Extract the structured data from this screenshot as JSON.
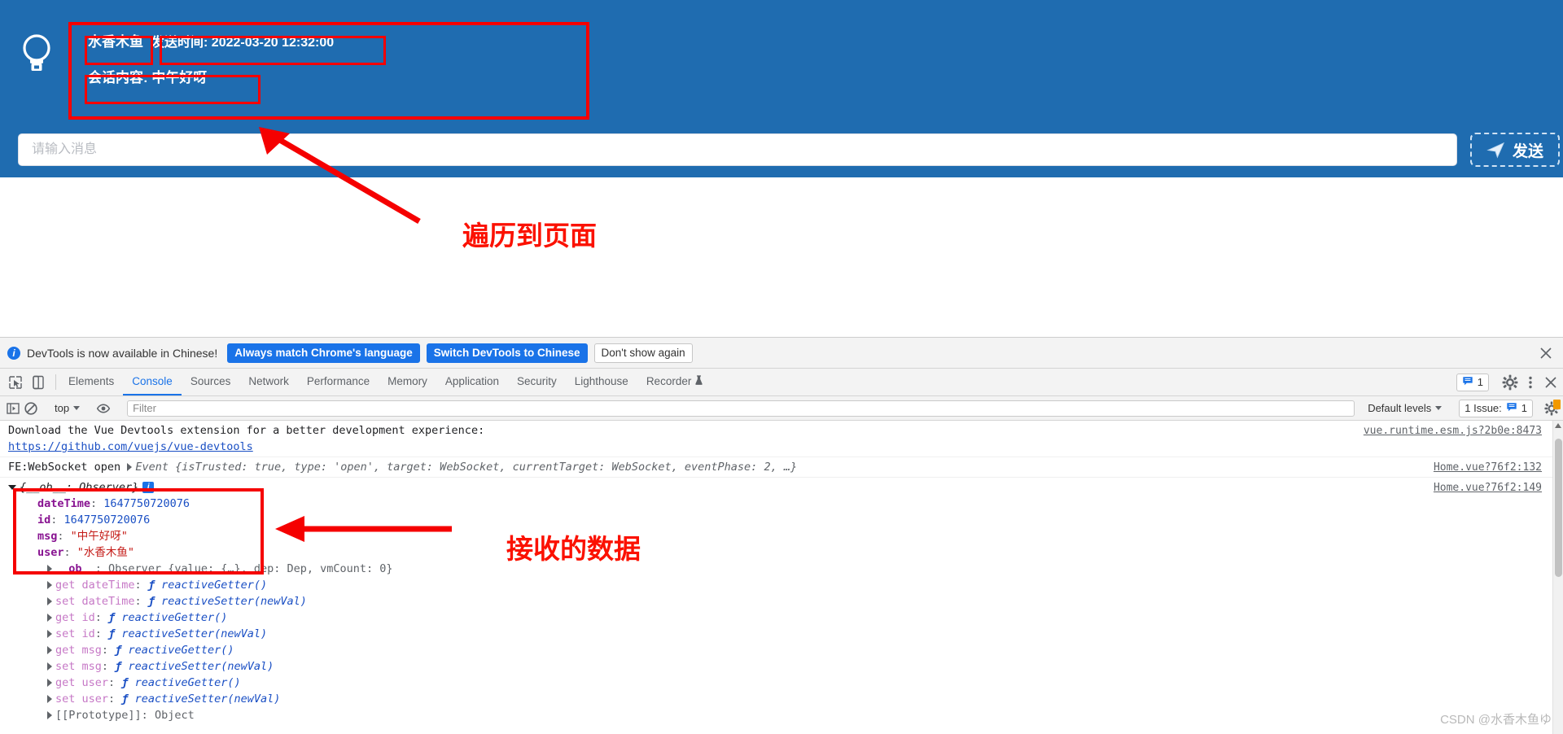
{
  "chat": {
    "avatar_icon": "lightbulb-icon",
    "message": {
      "user": "水香木鱼",
      "time_label": "发送时间:",
      "time_value": "2022-03-20 12:32:00",
      "content_label": "会话内容:",
      "content_value": "中午好呀"
    },
    "input_placeholder": "请输入消息",
    "input_value": "",
    "send_label": "发送",
    "send_icon": "paper-plane-icon",
    "accent_bg": "#1f6cb0"
  },
  "annotations": {
    "color": "#f50000",
    "note_page": "遍历到页面",
    "note_data": "接收的数据"
  },
  "devtools": {
    "language_bar": {
      "info_icon": "info-icon",
      "message": "DevTools is now available in Chinese!",
      "btn_always": "Always match Chrome's language",
      "btn_switch": "Switch DevTools to Chinese",
      "btn_dismiss": "Don't show again",
      "close_icon": "close-icon"
    },
    "tabs": [
      {
        "label": "Elements",
        "active": false
      },
      {
        "label": "Console",
        "active": true
      },
      {
        "label": "Sources",
        "active": false
      },
      {
        "label": "Network",
        "active": false
      },
      {
        "label": "Performance",
        "active": false
      },
      {
        "label": "Memory",
        "active": false
      },
      {
        "label": "Application",
        "active": false
      },
      {
        "label": "Security",
        "active": false
      },
      {
        "label": "Lighthouse",
        "active": false
      },
      {
        "label": "Recorder",
        "active": false
      }
    ],
    "dock_icons": [
      "inspect-element-icon",
      "device-toolbar-icon"
    ],
    "tabstrip_right": {
      "messages_count": "1",
      "messages_icon": "message-bubble-icon",
      "settings_icon": "gear-icon",
      "more_icon": "kebab-menu-icon",
      "close_icon": "close-icon"
    },
    "console_toolbar": {
      "sidebar_icon": "console-sidebar-icon",
      "clear_icon": "clear-console-icon",
      "context": "top",
      "eye_icon": "live-expression-icon",
      "filter_placeholder": "Filter",
      "filter_value": "",
      "levels": "Default levels",
      "issues_label": "1 Issue:",
      "issues_icon": "message-bubble-icon",
      "issues_count": "1",
      "settings_icon": "gear-icon"
    },
    "console_logs": [
      {
        "id": "vue-devtools-tip",
        "text": "Download the Vue Devtools extension for a better development experience:",
        "link": "https://github.com/vuejs/vue-devtools",
        "source": "vue.runtime.esm.js?2b0e:8473"
      },
      {
        "id": "websocket-open",
        "prefix": "FE:WebSocket open",
        "object": "Event {isTrusted: true, type: 'open', target: WebSocket, currentTarget: WebSocket, eventPhase: 2, …}",
        "source": "Home.vue?76f2:132"
      },
      {
        "id": "observer-object",
        "header": "{__ob__: Observer}",
        "source": "Home.vue?76f2:149",
        "props": [
          {
            "key": "dateTime",
            "value": "1647750720076",
            "kind": "number"
          },
          {
            "key": "id",
            "value": "1647750720076",
            "kind": "number"
          },
          {
            "key": "msg",
            "value": "\"中午好呀\"",
            "kind": "string"
          },
          {
            "key": "user",
            "value": "\"水香木鱼\"",
            "kind": "string"
          }
        ],
        "expanded": [
          {
            "key": "__ob__",
            "value": "Observer {value: {…}, dep: Dep, vmCount: 0}",
            "kind": "object"
          },
          {
            "key": "get dateTime",
            "value": "reactiveGetter()",
            "kind": "fn"
          },
          {
            "key": "set dateTime",
            "value": "reactiveSetter(newVal)",
            "kind": "fn"
          },
          {
            "key": "get id",
            "value": "reactiveGetter()",
            "kind": "fn"
          },
          {
            "key": "set id",
            "value": "reactiveSetter(newVal)",
            "kind": "fn"
          },
          {
            "key": "get msg",
            "value": "reactiveGetter()",
            "kind": "fn"
          },
          {
            "key": "set msg",
            "value": "reactiveSetter(newVal)",
            "kind": "fn"
          },
          {
            "key": "get user",
            "value": "reactiveGetter()",
            "kind": "fn"
          },
          {
            "key": "set user",
            "value": "reactiveSetter(newVal)",
            "kind": "fn"
          },
          {
            "key": "[[Prototype]]",
            "value": "Object",
            "kind": "proto"
          }
        ]
      }
    ]
  },
  "watermark": "CSDN @水香木鱼ゆ"
}
